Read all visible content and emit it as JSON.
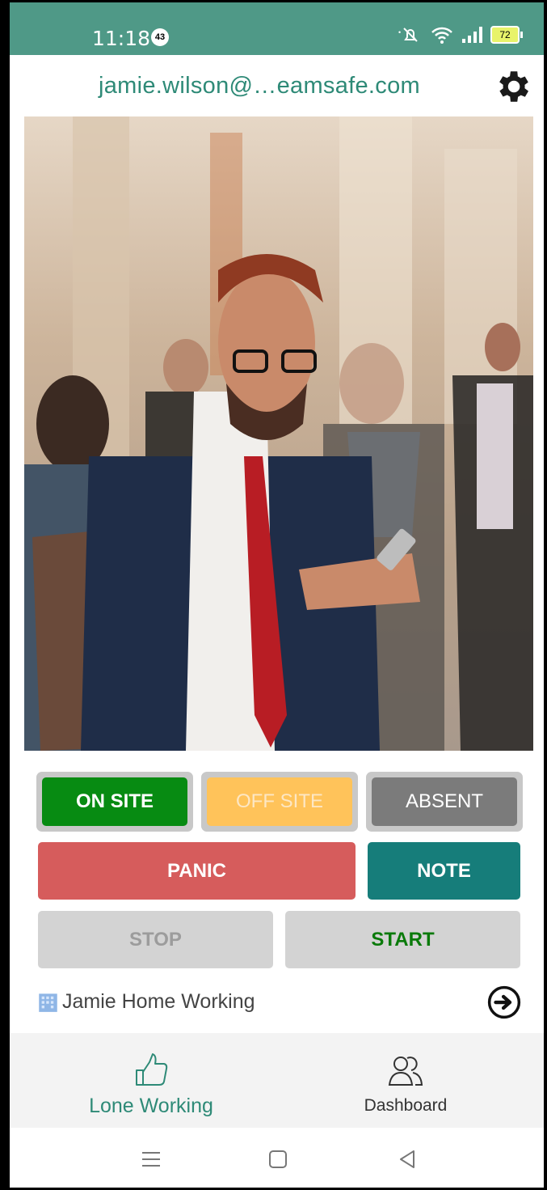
{
  "status_bar": {
    "time": "11:18",
    "notification_count": "43",
    "battery": "72"
  },
  "header": {
    "user_email": "jamie.wilson@…eamsafe.com"
  },
  "status_buttons": {
    "on_site": "ON SITE",
    "off_site": "OFF SITE",
    "absent": "ABSENT"
  },
  "actions": {
    "panic": "PANIC",
    "note": "NOTE",
    "stop": "STOP",
    "start": "START"
  },
  "location": {
    "name": "Jamie Home Working"
  },
  "tabs": [
    {
      "label": "Lone Working",
      "icon": "thumbs-up-icon",
      "active": true
    },
    {
      "label": "Dashboard",
      "icon": "users-icon",
      "active": false
    }
  ],
  "colors": {
    "accent": "#2e8a77",
    "status_bar": "#4f9987",
    "on_site": "#078b12",
    "off_site": "#ffc35a",
    "absent": "#7b7b7b",
    "panic": "#d65c5c",
    "note": "#167d7a"
  }
}
